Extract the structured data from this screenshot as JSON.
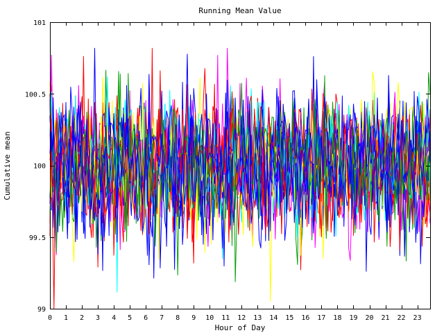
{
  "chart_data": {
    "type": "line",
    "title": "Running Mean Value",
    "xlabel": "Hour of Day",
    "ylabel": "Cumulative mean",
    "xlim": [
      0,
      23.8
    ],
    "ylim": [
      99,
      101
    ],
    "x_ticks": [
      "0",
      "1",
      "2",
      "3",
      "4",
      "5",
      "6",
      "7",
      "8",
      "9",
      "10",
      "11",
      "12",
      "13",
      "14",
      "15",
      "16",
      "17",
      "18",
      "19",
      "20",
      "21",
      "22",
      "23"
    ],
    "y_ticks": [
      "99",
      "99.5",
      "100",
      "100.5",
      "101"
    ],
    "grid": false,
    "legend": "none",
    "series_colors": [
      "#0000ff",
      "#ff0000",
      "#00a000",
      "#ff00ff",
      "#00ffff",
      "#ffff00",
      "#0000ff",
      "#ff0000",
      "#0000ff",
      "#00a000",
      "#ff00ff",
      "#0000ff",
      "#ff0000",
      "#00ffff",
      "#0000ff",
      "#ffff00",
      "#0000ff",
      "#ff0000",
      "#00a000",
      "#0000ff"
    ],
    "series": [
      {
        "x_step": 0.1,
        "summary": {
          "mean": 100.0,
          "min": 99.0,
          "max": 100.82
        },
        "note": ""
      }
    ],
    "generation": {
      "n_series": 20,
      "points_per_series": 239,
      "center": 100.0,
      "spread": 0.23,
      "seed": 7
    }
  }
}
